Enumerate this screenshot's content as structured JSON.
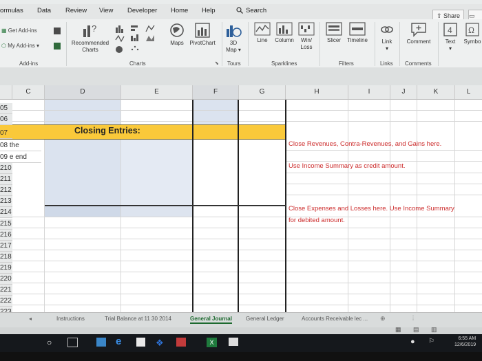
{
  "menu": {
    "tabs": [
      "ormulas",
      "Data",
      "Review",
      "View",
      "Developer",
      "Home",
      "Help"
    ],
    "search_label": "Search",
    "share_label": "Share"
  },
  "ribbon": {
    "get_addins": "Get Add-ins",
    "my_addins": "My Add-ins",
    "addins_group": "Add-ins",
    "recommended_charts": [
      "Recommended",
      "Charts"
    ],
    "maps": "Maps",
    "pivotchart": "PivotChart",
    "charts_group": "Charts",
    "map3d": [
      "3D",
      "Map"
    ],
    "tours_group": "Tours",
    "line": "Line",
    "column": "Column",
    "winloss": [
      "Win/",
      "Loss"
    ],
    "sparklines_group": "Sparklines",
    "slicer": "Slicer",
    "timeline": "Timeline",
    "filters_group": "Filters",
    "link": "Link",
    "links_group": "Links",
    "comment": "Comment",
    "comments_group": "Comments",
    "text": "Text",
    "symbols": "Symbo"
  },
  "grid": {
    "columns": [
      "C",
      "D",
      "E",
      "F",
      "G",
      "H",
      "I",
      "J",
      "K",
      "L"
    ],
    "rows": [
      "05",
      "06",
      "07",
      "08 the",
      "09 e end",
      "210",
      "211",
      "212",
      "213",
      "214",
      "215",
      "216",
      "217",
      "218",
      "219",
      "220",
      "221",
      "222",
      "223"
    ],
    "banner_title": "Closing Entries:",
    "note1": "Close Revenues, Contra-Revenues, and Gains here.",
    "note2": "Use Income Summary as credit amount.",
    "note3_line1": "Close Expenses and Losses here.  Use Income Summary",
    "note3_line2": "for debited amount."
  },
  "sheets": {
    "tabs": [
      "Instructions",
      "Trial Balance at 11 30 2014",
      "General Journal",
      "General Ledger",
      "Accounts Receivable lec ..."
    ],
    "active": "General Journal"
  },
  "taskbar": {
    "time": "6:55 AM",
    "date": "12/6/2019"
  },
  "colors": {
    "banner": "#fac93a",
    "note_red": "#cc2b2b",
    "active_tab_green": "#1d6a2f",
    "cell_shade": "#dbe3ef"
  }
}
